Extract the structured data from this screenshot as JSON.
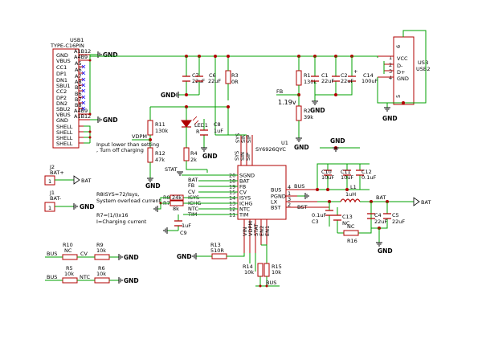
{
  "usb1": {
    "ref": "USB1",
    "value": "TYPE-C16PIN",
    "pins": [
      "GND",
      "VBUS",
      "CC1",
      "DP1",
      "DN1",
      "SBU1",
      "CC2",
      "DP2",
      "DN2",
      "SBU2",
      "VBUS",
      "GND",
      "SHELL",
      "SHELL",
      "SHELL",
      "SHELL"
    ],
    "pin_numbers": [
      "A1B12",
      "A4B9",
      "A5",
      "A6",
      "A7",
      "A8",
      "B5",
      "B6",
      "B7",
      "B8",
      "A4B9",
      "A1B12"
    ]
  },
  "usb2": {
    "ref": "USB",
    "ref2": "USB2",
    "pins": [
      "VCC",
      "D-",
      "D+",
      "GND"
    ],
    "pin_numbers": [
      "1",
      "2",
      "3",
      "4",
      "5",
      "6"
    ]
  },
  "u1": {
    "ref": "U1",
    "value": "SY6926QYC",
    "left_pins": [
      {
        "num": "20",
        "name": "SGND"
      },
      {
        "num": "18",
        "name": "BAT"
      },
      {
        "num": "19",
        "name": "FB"
      },
      {
        "num": "15",
        "name": "CV"
      },
      {
        "num": "14",
        "name": "ISYS"
      },
      {
        "num": "13",
        "name": "ICHG"
      },
      {
        "num": "12",
        "name": "NTC"
      },
      {
        "num": "11",
        "name": "TIM"
      }
    ],
    "right_pins": [
      {
        "num": "4",
        "name": "BUS"
      },
      {
        "num": "1",
        "name": "PGND"
      },
      {
        "num": "3",
        "name": "LX"
      },
      {
        "num": "2",
        "name": "BST"
      }
    ],
    "top_pins": [
      "SYS",
      "SIN",
      "SIP"
    ],
    "bottom_pins": [
      "VIN",
      "VDPM",
      "STAT",
      "EN2",
      "EN1"
    ]
  },
  "components": {
    "c7": {
      "ref": "C7",
      "value": "22uF"
    },
    "c6": {
      "ref": "C6",
      "value": "22uF"
    },
    "r3": {
      "ref": "R3",
      "value": "0R"
    },
    "c8": {
      "ref": "C8",
      "value": "1uF"
    },
    "r11": {
      "ref": "R11",
      "value": "130k"
    },
    "r12": {
      "ref": "R12",
      "value": "47k"
    },
    "led1": {
      "ref": "LED1",
      "value": "R"
    },
    "r4": {
      "ref": "R4",
      "value": "2k"
    },
    "r1": {
      "ref": "R1",
      "value": "130k"
    },
    "c1": {
      "ref": "C1",
      "value": "22uF"
    },
    "c2": {
      "ref": "C2",
      "value": "22uF"
    },
    "c14": {
      "ref": "C14",
      "value": "100uF"
    },
    "r2": {
      "ref": "R2",
      "value": "39k"
    },
    "r8": {
      "ref": "R8",
      "value": "24k"
    },
    "r7": {
      "ref": "R7",
      "value": "8k"
    },
    "c9": {
      "ref": "C9",
      "value": "1uF"
    },
    "c10": {
      "ref": "C10",
      "value": "10uF"
    },
    "c11": {
      "ref": "C11",
      "value": "10uF"
    },
    "c12": {
      "ref": "C12",
      "value": "0.1uF"
    },
    "l1": {
      "ref": "L1",
      "value": "1uH"
    },
    "c3": {
      "ref": "C3",
      "value": "0.1uF"
    },
    "c13": {
      "ref": "C13",
      "value": "NC"
    },
    "r16": {
      "ref": "R16",
      "value": "NC"
    },
    "c4": {
      "ref": "C4",
      "value": "22uF"
    },
    "c5": {
      "ref": "C5",
      "value": "22uF"
    },
    "r13": {
      "ref": "R13",
      "value": "510R"
    },
    "r14": {
      "ref": "R14",
      "value": "10k"
    },
    "r15": {
      "ref": "R15",
      "value": "10k"
    },
    "r10": {
      "ref": "R10",
      "value": "NC"
    },
    "r9": {
      "ref": "R9",
      "value": "10k"
    },
    "r5": {
      "ref": "R5",
      "value": "10k"
    },
    "r6": {
      "ref": "R6",
      "value": "10k"
    }
  },
  "connectors": {
    "j2": {
      "ref": "J2",
      "label": "BAT+"
    },
    "j1": {
      "ref": "J1",
      "label": "BAT-"
    },
    "pin": "1"
  },
  "nets": {
    "gnd": "GND",
    "vdpm": "VDPM",
    "stat": "STAT",
    "bat": "BAT",
    "bus": "BUS",
    "cv": "CV",
    "ntc": "NTC",
    "fb": "FB",
    "isys": "ISYS",
    "ichg": "ICHG",
    "tim": "TIM",
    "bst": "BST",
    "sys": "SYS",
    "sin": "SIN",
    "sip": "SIP"
  },
  "annotations": {
    "fb_voltage": "1.19v",
    "vdpm_note_1": "Input lower than setting",
    "vdpm_note_2": ", Turn off charging",
    "isys_note_1": "R8ISYS=72/Isys,",
    "isys_note_2": "System overload current",
    "ichg_note_1": "R7=(1/I)x16",
    "ichg_note_2": "I=Charging current"
  }
}
